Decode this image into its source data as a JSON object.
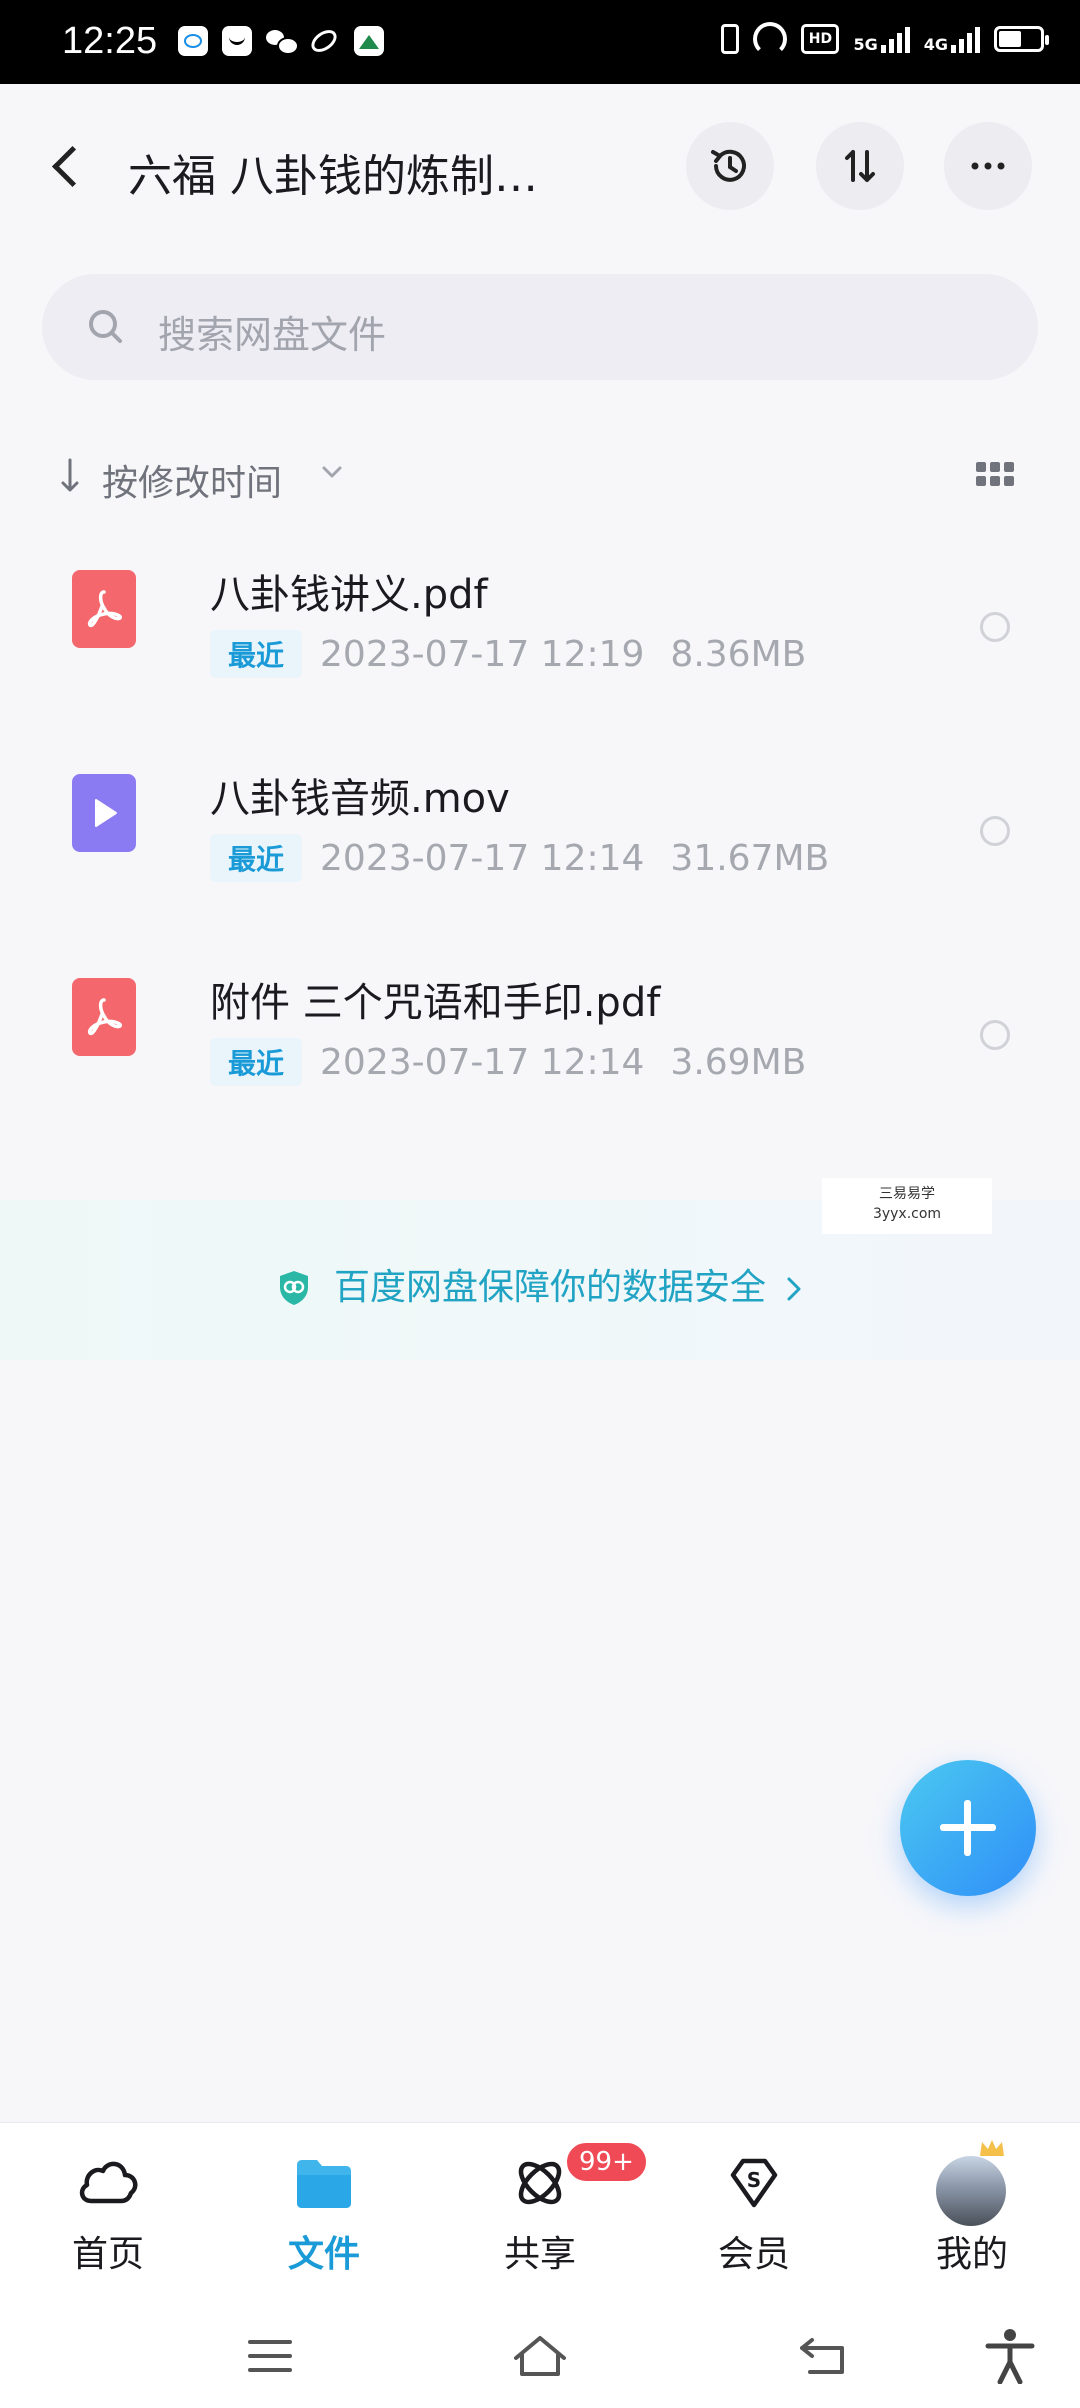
{
  "status_bar": {
    "time": "12:25",
    "hd_label": "HD",
    "network_5g": "5G",
    "network_4g": "4G"
  },
  "header": {
    "title": "六福 八卦钱的炼制…",
    "icons": [
      "back-icon",
      "history-icon",
      "sort-icon",
      "more-icon"
    ]
  },
  "search": {
    "placeholder": "搜索网盘文件"
  },
  "sort": {
    "label": "按修改时间"
  },
  "files": [
    {
      "name": "八卦钱讲义.pdf",
      "badge": "最近",
      "date": "2023-07-17  12:19",
      "size": "8.36MB",
      "type": "pdf"
    },
    {
      "name": "八卦钱音频.mov",
      "badge": "最近",
      "date": "2023-07-17  12:14",
      "size": "31.67MB",
      "type": "video"
    },
    {
      "name": "附件 三个咒语和手印.pdf",
      "badge": "最近",
      "date": "2023-07-17  12:14",
      "size": "3.69MB",
      "type": "pdf"
    }
  ],
  "security_banner": {
    "text": "百度网盘保障你的数据安全"
  },
  "watermark": {
    "line1": "三易易学",
    "line2": "3yyx.com"
  },
  "tabbar": {
    "tabs": [
      {
        "label": "首页",
        "icon": "cloud-icon"
      },
      {
        "label": "文件",
        "icon": "folder-icon",
        "active": true
      },
      {
        "label": "共享",
        "icon": "share-icon"
      },
      {
        "label": "会员",
        "icon": "vip-icon"
      },
      {
        "label": "我的",
        "icon": "avatar"
      }
    ],
    "share_badge": "99+"
  },
  "colors": {
    "accent": "#1a9bd7",
    "pdf": "#f4676c",
    "video": "#8b7bf2",
    "fab": "#2e8ef8",
    "badge": "#f04a56"
  }
}
